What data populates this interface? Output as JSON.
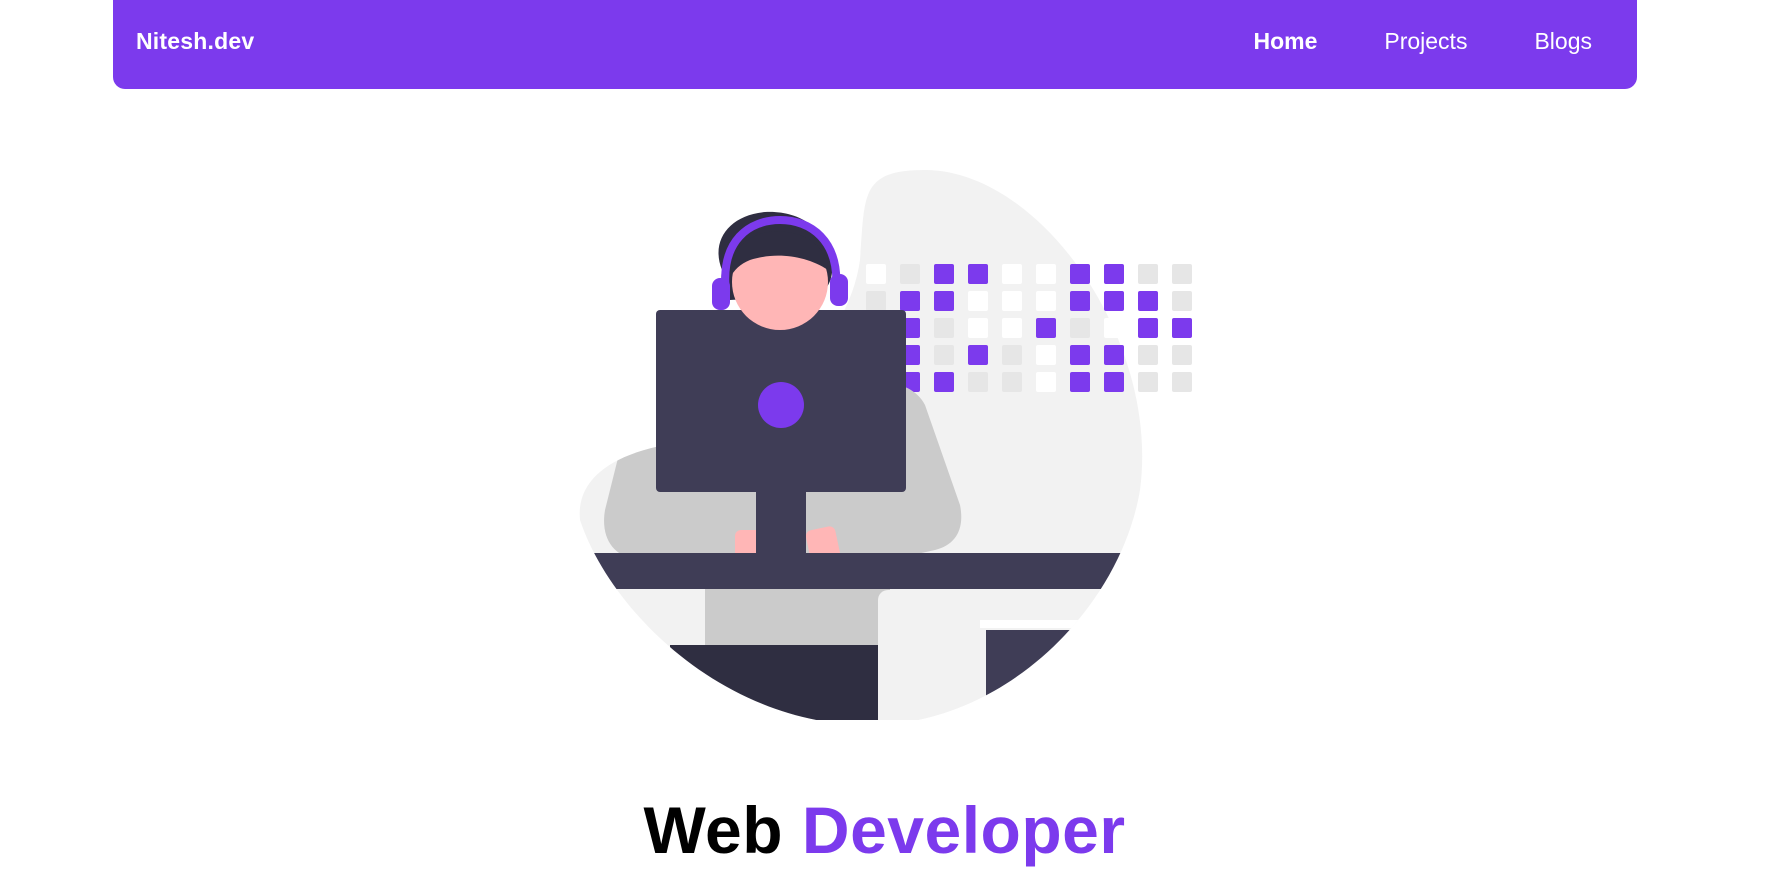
{
  "nav": {
    "brand": "Nitesh.dev",
    "links": [
      {
        "label": "Home",
        "active": true
      },
      {
        "label": "Projects",
        "active": false
      },
      {
        "label": "Blogs",
        "active": false
      }
    ]
  },
  "hero": {
    "title_part1": "Web",
    "title_part2": "Developer",
    "illustration": "developer-with-headphones-at-monitor"
  },
  "colors": {
    "accent": "#7c3aed",
    "dark": "#3f3d56",
    "skin": "#ffb6b6",
    "light_gray": "#f2f2f2",
    "mid_gray": "#cbcbcb"
  }
}
